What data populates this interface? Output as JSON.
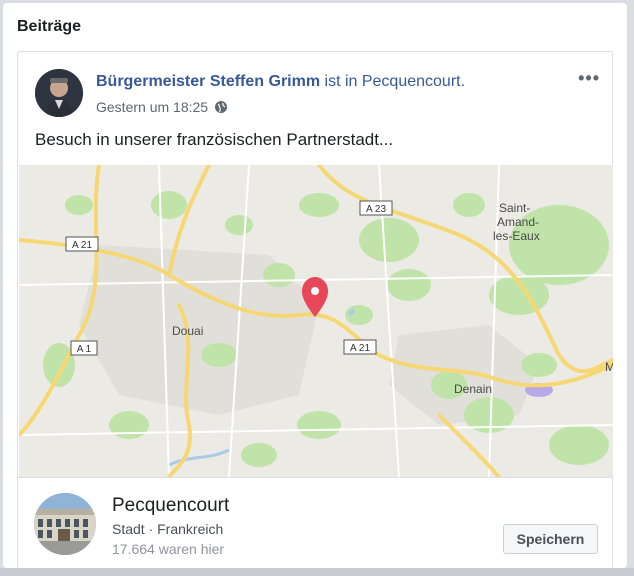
{
  "section": {
    "title": "Beiträge"
  },
  "post": {
    "author": "Bürgermeister Steffen Grimm",
    "location_prefix": " ist in ",
    "location": "Pecquencourt.",
    "timestamp": "Gestern um 18:25",
    "privacy_icon": "globe-icon",
    "more_label": "•••",
    "text": "Besuch in unserer französischen Partnerstadt..."
  },
  "map": {
    "labels": {
      "douai": "Douai",
      "denain": "Denain",
      "saint_amand_1": "Saint-",
      "saint_amand_2": "Amand-",
      "saint_amand_3": "les-Eaux",
      "edge": "M"
    },
    "roads": {
      "a21_west": "A 21",
      "a21_east": "A 21",
      "a23": "A 23",
      "a1": "A 1"
    },
    "marker_icon": "map-pin-icon"
  },
  "place": {
    "name": "Pecquencourt",
    "category": "Stadt · Frankreich",
    "checkins": "17.664 waren hier",
    "save_label": "Speichern"
  },
  "colors": {
    "link": "#385898",
    "pin": "#e8475a",
    "road": "#f7d774"
  }
}
